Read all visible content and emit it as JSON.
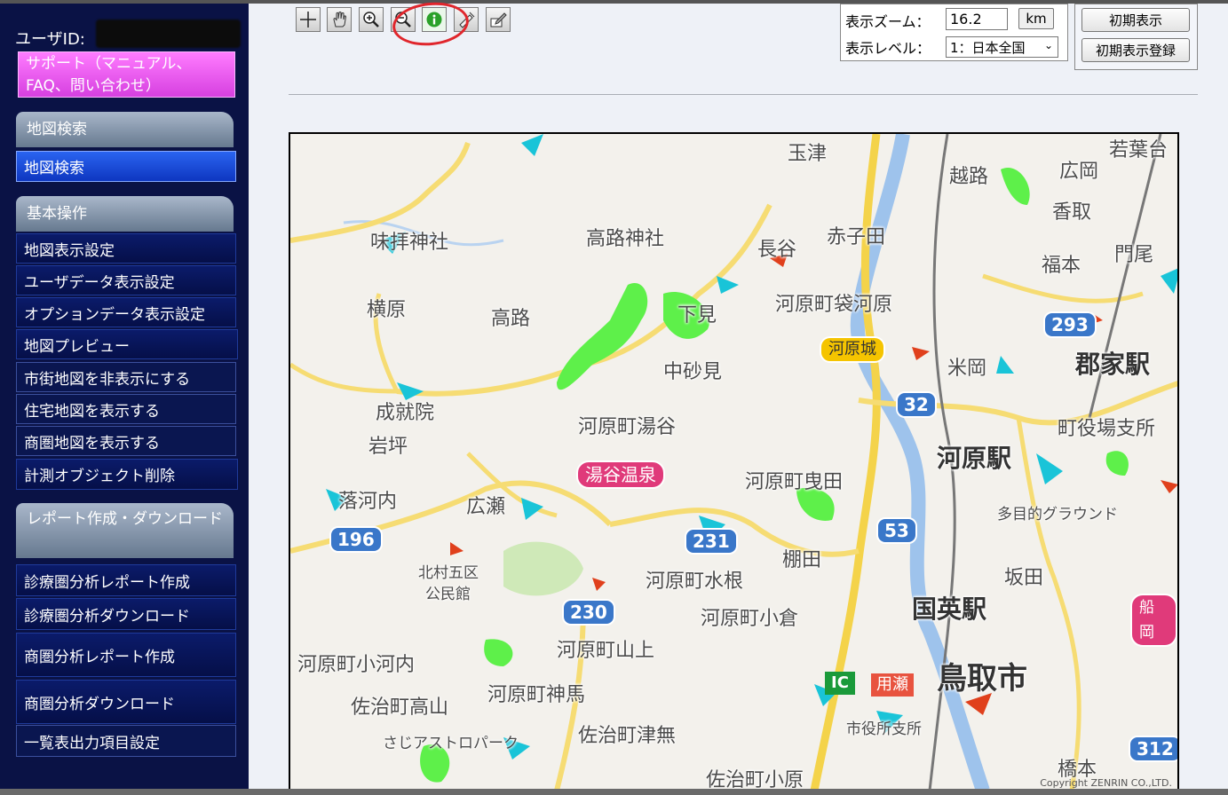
{
  "sidebar": {
    "user_label": "ユーザID:",
    "support": "サポート（マニュアル、FAQ、問い合わせ）",
    "sections": [
      {
        "title": "地図検索"
      },
      {
        "title": "基本操作"
      },
      {
        "title": "レポート作成・ダウンロード"
      }
    ],
    "search_items": [
      "地図検索"
    ],
    "basic_items": [
      "地図表示設定",
      "ユーザデータ表示設定",
      "オプションデータ表示設定",
      "地図プレビュー",
      "市街地図を非表示にする",
      "住宅地図を表示する",
      "商圏地図を表示する",
      "計測オブジェクト削除"
    ],
    "report_items": [
      "診療圏分析レポート作成",
      "診療圏分析ダウンロード",
      "商圏分析レポート作成",
      "商圏分析ダウンロード",
      "一覧表出力項目設定"
    ]
  },
  "toolbar": {
    "tools": [
      "crosshair-icon",
      "hand-pan-icon",
      "zoom-in-icon",
      "zoom-out-icon",
      "info-icon",
      "measure-ruler-icon",
      "edit-pen-icon"
    ]
  },
  "zoom": {
    "zoom_label": "表示ズーム：",
    "zoom_value": "16.2",
    "unit": "km",
    "level_label": "表示レベル：",
    "level_value": "1：日本全国"
  },
  "initial": {
    "show_label": "初期表示",
    "register_label": "初期表示登録"
  },
  "map": {
    "labels": {
      "tamatsu": "玉津",
      "koshiro": "越路",
      "hirooka": "広岡",
      "wakamaki": "若葉台",
      "kago": "香取",
      "misashrine": "味拝神社",
      "takajishrine": "高路神社",
      "nagatani": "長谷",
      "akasoda": "赤子田",
      "fukumoto": "福本",
      "monzen": "門尾",
      "yokohara": "横原",
      "takaji": "高路",
      "shimomi": "下見",
      "fukuro": "河原町袋河原",
      "nakasami": "中砂見",
      "yoneoka": "米岡",
      "koge_st": "郡家駅",
      "jojuin": "成就院",
      "yugaya": "河原町湯谷",
      "yakuba": "町役場支所",
      "iwatsubo": "岩坪",
      "kawahara_st": "河原駅",
      "kamita": "河原町曳田",
      "tagui": "多目的グラウンド",
      "ochikochi": "落河内",
      "hirose": "広瀬",
      "kitamura": "北村五区",
      "komin": "公民館",
      "mizune": "河原町水根",
      "tanada": "棚田",
      "sakata": "坂田",
      "kokufu_st": "国英駅",
      "ogura": "河原町小倉",
      "yamagami": "河原町山上",
      "okouchi": "河原町小河内",
      "tottori": "鳥取市",
      "kamitani": "河原町神馬",
      "takayama": "佐治町高山",
      "shisho": "市役所支所",
      "tsuna": "佐治町津無",
      "astro": "さじアストロパーク",
      "hashimoto": "橋本",
      "kodaira": "佐治町小原"
    },
    "routes": [
      "293",
      "32",
      "196",
      "53",
      "230",
      "231",
      "312"
    ],
    "pills": {
      "onsen": "湯谷温泉",
      "kawahara_pin": "河原城",
      "ic": "IC",
      "mochigase": "用瀬",
      "funaoka": "船岡"
    },
    "copyright": "Copyright ZENRIN CO.,LTD."
  },
  "colors": {
    "sidebar_bg": "#0a1245",
    "support_bg": "#e050ec",
    "active_btn": "#1e4fe0",
    "annotation_circle": "#e0262c"
  }
}
